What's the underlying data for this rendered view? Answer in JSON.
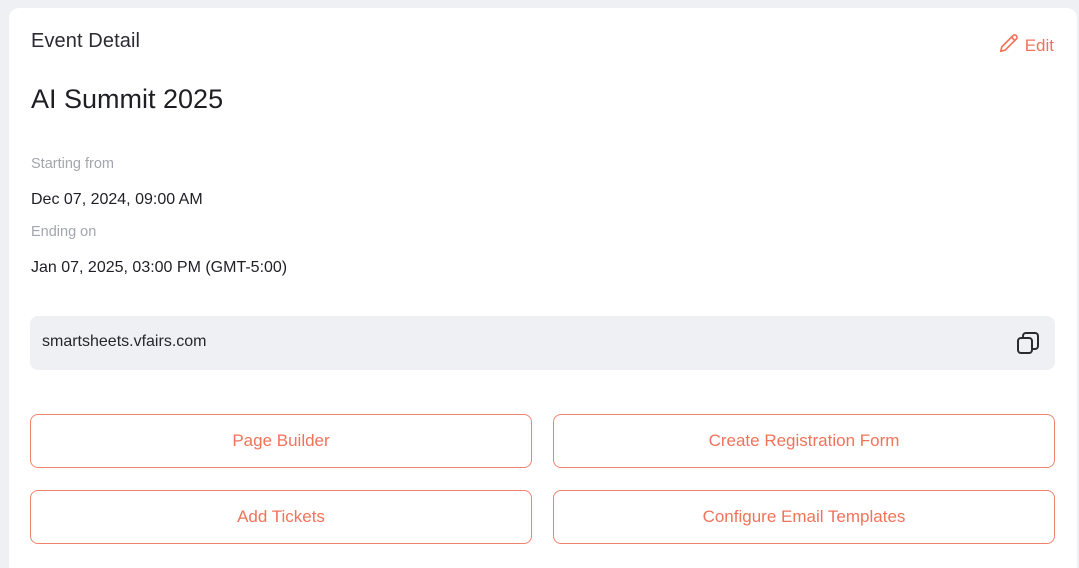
{
  "header": {
    "section_title": "Event Detail",
    "edit_label": "Edit"
  },
  "event": {
    "title": "AI Summit 2025",
    "start_label": "Starting from",
    "start_value": "Dec 07, 2024, 09:00 AM",
    "end_label": "Ending on",
    "end_value": "Jan 07, 2025, 03:00 PM (GMT-5:00)"
  },
  "url": {
    "value": "smartsheets.vfairs.com",
    "copy_icon": "copy-icon"
  },
  "actions": {
    "page_builder": "Page Builder",
    "create_registration_form": "Create Registration Form",
    "add_tickets": "Add Tickets",
    "configure_email_templates": "Configure Email Templates"
  },
  "colors": {
    "accent": "#f0735a",
    "background": "#eef0f4",
    "card": "#ffffff",
    "url_box": "#eff0f3"
  }
}
